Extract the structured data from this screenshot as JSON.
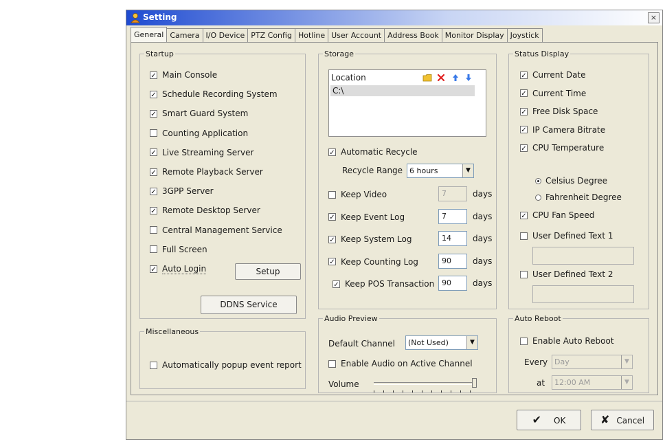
{
  "window": {
    "title": "Setting",
    "close_glyph": "×"
  },
  "tabs": [
    "General",
    "Camera",
    "I/O Device",
    "PTZ Config",
    "Hotline",
    "User Account",
    "Address Book",
    "Monitor Display",
    "Joystick"
  ],
  "startup": {
    "legend": "Startup",
    "items": [
      {
        "label": "Main Console",
        "checked": true
      },
      {
        "label": "Schedule Recording System",
        "checked": true
      },
      {
        "label": "Smart Guard System",
        "checked": true
      },
      {
        "label": "Counting Application",
        "checked": false
      },
      {
        "label": "Live Streaming Server",
        "checked": true
      },
      {
        "label": "Remote Playback Server",
        "checked": true
      },
      {
        "label": "3GPP Server",
        "checked": true
      },
      {
        "label": "Remote Desktop Server",
        "checked": true
      },
      {
        "label": "Central Management Service",
        "checked": false
      },
      {
        "label": "Full Screen",
        "checked": false
      },
      {
        "label": "Auto Login",
        "checked": true
      }
    ],
    "setup_button": "Setup",
    "ddns_button": "DDNS Service"
  },
  "misc": {
    "legend": "Miscellaneous",
    "item": {
      "label": "Automatically popup event report",
      "checked": false
    }
  },
  "storage": {
    "legend": "Storage",
    "location_header": "Location",
    "locations": [
      "C:\\"
    ],
    "auto_recycle": {
      "label": "Automatic Recycle",
      "checked": true
    },
    "recycle_range_label": "Recycle Range",
    "recycle_range_value": "6 hours",
    "keeps": [
      {
        "label": "Keep Video",
        "checked": false,
        "value": "7",
        "unit": "days",
        "disabled": true
      },
      {
        "label": "Keep Event Log",
        "checked": true,
        "value": "7",
        "unit": "days",
        "disabled": false
      },
      {
        "label": "Keep System Log",
        "checked": true,
        "value": "14",
        "unit": "days",
        "disabled": false
      },
      {
        "label": "Keep Counting Log",
        "checked": true,
        "value": "90",
        "unit": "days",
        "disabled": false
      },
      {
        "label": "Keep POS Transaction",
        "checked": true,
        "value": "90",
        "unit": "days",
        "disabled": false
      }
    ]
  },
  "status_display": {
    "legend": "Status Display",
    "items": [
      {
        "label": "Current Date",
        "checked": true
      },
      {
        "label": "Current Time",
        "checked": true
      },
      {
        "label": "Free Disk Space",
        "checked": true
      },
      {
        "label": "IP Camera Bitrate",
        "checked": true
      },
      {
        "label": "CPU Temperature",
        "checked": true
      }
    ],
    "radios": [
      {
        "label": "Celsius Degree",
        "selected": true
      },
      {
        "label": "Fahrenheit Degree",
        "selected": false
      }
    ],
    "cpu_fan": {
      "label": "CPU Fan Speed",
      "checked": true
    },
    "user_text1": {
      "label": "User Defined Text 1",
      "checked": false,
      "value": ""
    },
    "user_text2": {
      "label": "User Defined Text 2",
      "checked": false,
      "value": ""
    }
  },
  "audio": {
    "legend": "Audio Preview",
    "default_channel_label": "Default Channel",
    "default_channel_value": "(Not Used)",
    "enable_audio": {
      "label": "Enable Audio on Active Channel",
      "checked": false
    },
    "volume_label": "Volume",
    "volume_level": 1.0
  },
  "auto_reboot": {
    "legend": "Auto Reboot",
    "enable": {
      "label": "Enable Auto Reboot",
      "checked": false
    },
    "every_label": "Every",
    "every_value": "Day",
    "at_label": "at",
    "at_value": "12:00 AM"
  },
  "footer": {
    "ok_label": "OK",
    "ok_glyph": "✔",
    "cancel_label": "Cancel",
    "cancel_glyph": "✘"
  },
  "glyphs": {
    "check": "✓",
    "dropdown": "▼"
  },
  "icons": [
    "folder-icon",
    "delete-icon",
    "move-up-icon",
    "move-down-icon",
    "app-icon"
  ],
  "colors": {
    "titlebar": "#1f4bd1",
    "panel": "#ece9d8",
    "selection": "#dcdcdc"
  }
}
